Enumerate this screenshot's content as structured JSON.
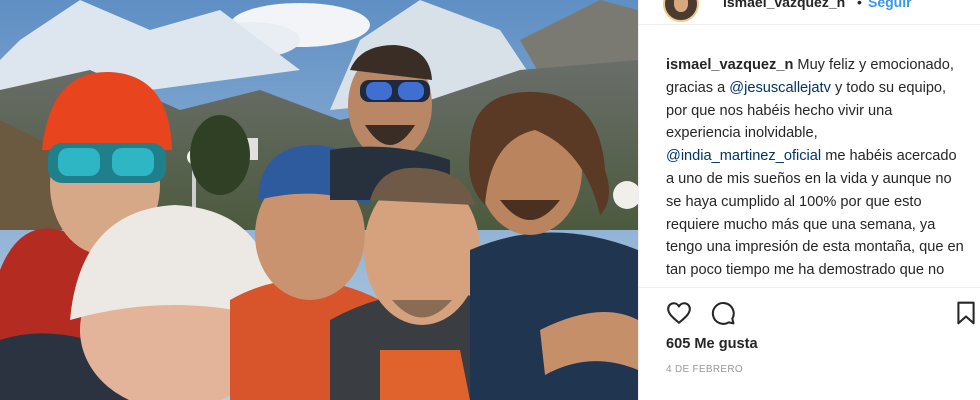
{
  "header": {
    "username": "ismael_vazquez_n",
    "separator": "•",
    "follow_label": "Seguir"
  },
  "caption": {
    "username": "ismael_vazquez_n",
    "text_1": " Muy feliz y emocionado, gracias a ",
    "mention_1": "@jesuscallejatv",
    "text_2": " y todo su equipo, por que nos habéis hecho vivir una experiencia inolvidable, ",
    "mention_2": "@india_martinez_oficial",
    "text_3": " me habéis acercado a uno de mis sueños en la vida y aunque no se haya cumplido al 100% por que esto requiere mucho más que una semana, ya tengo una impresión de esta montaña, que en tan poco tiempo me ha demostrado que no está al alcance de cualquiera, que no se le"
  },
  "actions": {
    "like_icon": "heart-outline-icon",
    "comment_icon": "speech-bubble-icon",
    "save_icon": "bookmark-icon"
  },
  "likes_text": "605 Me gusta",
  "date_text": "4 DE FEBRERO",
  "colors": {
    "link": "#003569",
    "follow": "#3897f0",
    "text": "#262626",
    "muted": "#999999",
    "border": "#efefef"
  }
}
